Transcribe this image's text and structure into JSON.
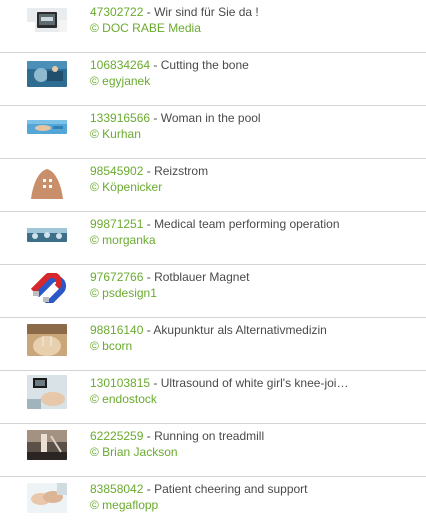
{
  "items": [
    {
      "id": "47302722",
      "title": "Wir sind für Sie da !",
      "credit": "© DOC RABE Media",
      "thumb": "doctor-tablet"
    },
    {
      "id": "106834264",
      "title": "Cutting the bone",
      "credit": "© egyjanek",
      "thumb": "surgery"
    },
    {
      "id": "133916566",
      "title": "Woman in the pool",
      "credit": "© Kurhan",
      "thumb": "pool"
    },
    {
      "id": "98545902",
      "title": "Reizstrom",
      "credit": "© Köpenicker",
      "thumb": "back-electrodes"
    },
    {
      "id": "99871251",
      "title": "Medical team performing operation",
      "credit": "© morganka",
      "thumb": "operation"
    },
    {
      "id": "97672766",
      "title": "Rotblauer Magnet",
      "credit": "© psdesign1",
      "thumb": "magnet"
    },
    {
      "id": "98816140",
      "title": "Akupunktur als Alternativmedizin",
      "credit": "© bcorn",
      "thumb": "acupuncture"
    },
    {
      "id": "130103815",
      "title": "Ultrasound of white girl's knee-joi…",
      "credit": "© endostock",
      "thumb": "ultrasound"
    },
    {
      "id": "62225259",
      "title": "Running on treadmill",
      "credit": "© Brian Jackson",
      "thumb": "treadmill"
    },
    {
      "id": "83858042",
      "title": "Patient cheering and support",
      "credit": "© megaflopp",
      "thumb": "hands-support"
    }
  ],
  "separator": " - ",
  "colors": {
    "id_green": "#6aab2f",
    "title_gray": "#4a4a4a",
    "divider": "#d4d4d4"
  }
}
